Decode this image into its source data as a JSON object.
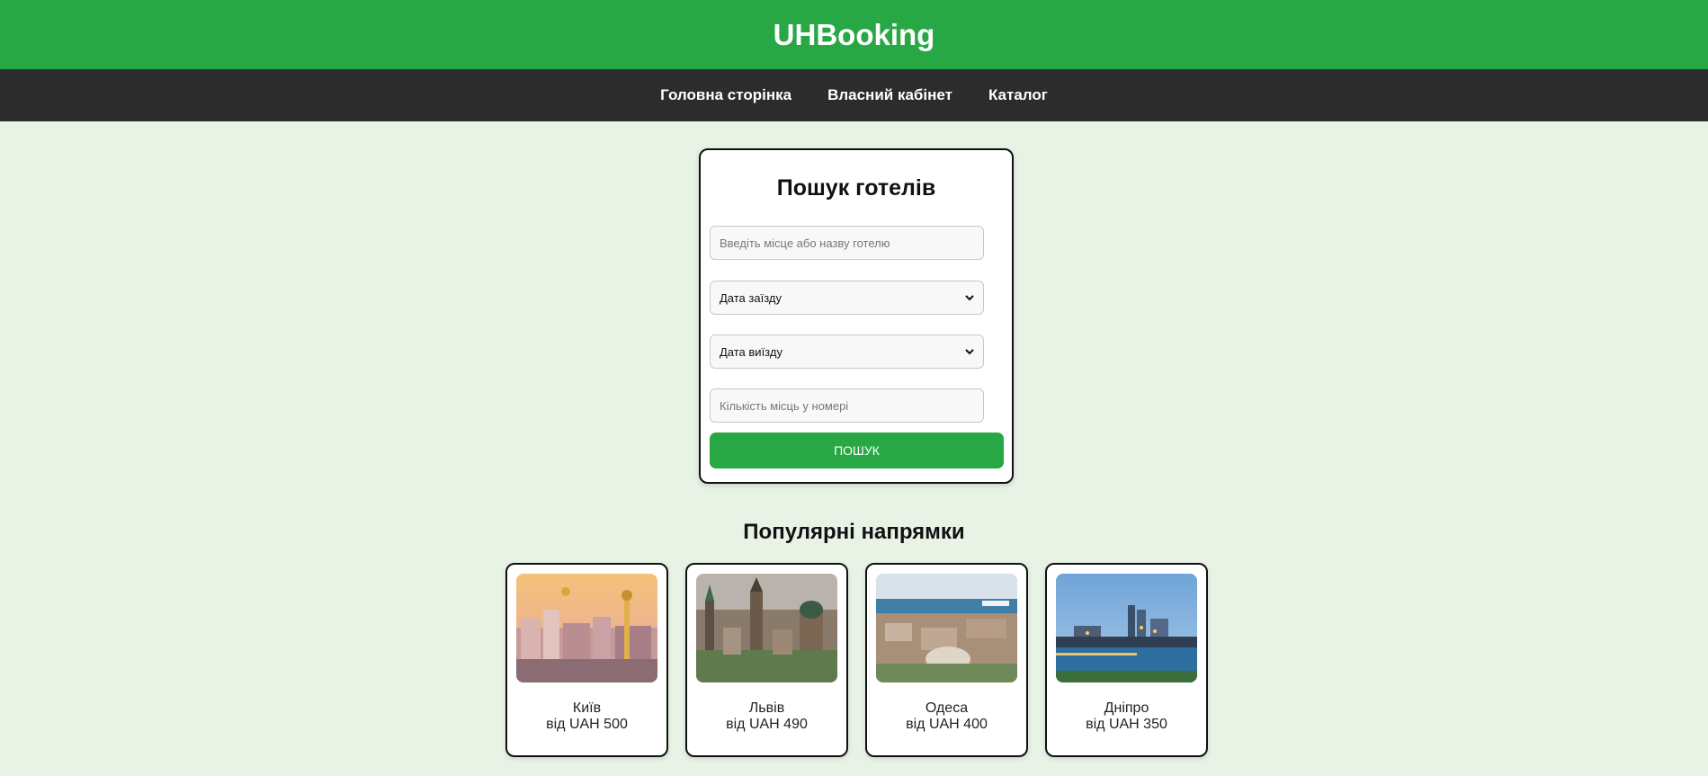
{
  "header": {
    "title": "UHBooking",
    "brand_color": "#28a845"
  },
  "nav": {
    "items": [
      {
        "label": "Головна сторінка"
      },
      {
        "label": "Власний кабінет"
      },
      {
        "label": "Каталог"
      }
    ]
  },
  "search": {
    "title": "Пошук готелів",
    "location_placeholder": "Введіть місце або назву готелю",
    "checkin_label": "Дата заїзду",
    "checkout_label": "Дата виїзду",
    "guests_placeholder": "Кількість місць у номері",
    "button_label": "ПОШУК"
  },
  "popular": {
    "title": "Популярні напрямки",
    "destinations": [
      {
        "city": "Київ",
        "price": "від UAH 500"
      },
      {
        "city": "Львів",
        "price": "від UAH 490"
      },
      {
        "city": "Одеса",
        "price": "від UAH 400"
      },
      {
        "city": "Дніпро",
        "price": "від UAH 350"
      }
    ]
  }
}
